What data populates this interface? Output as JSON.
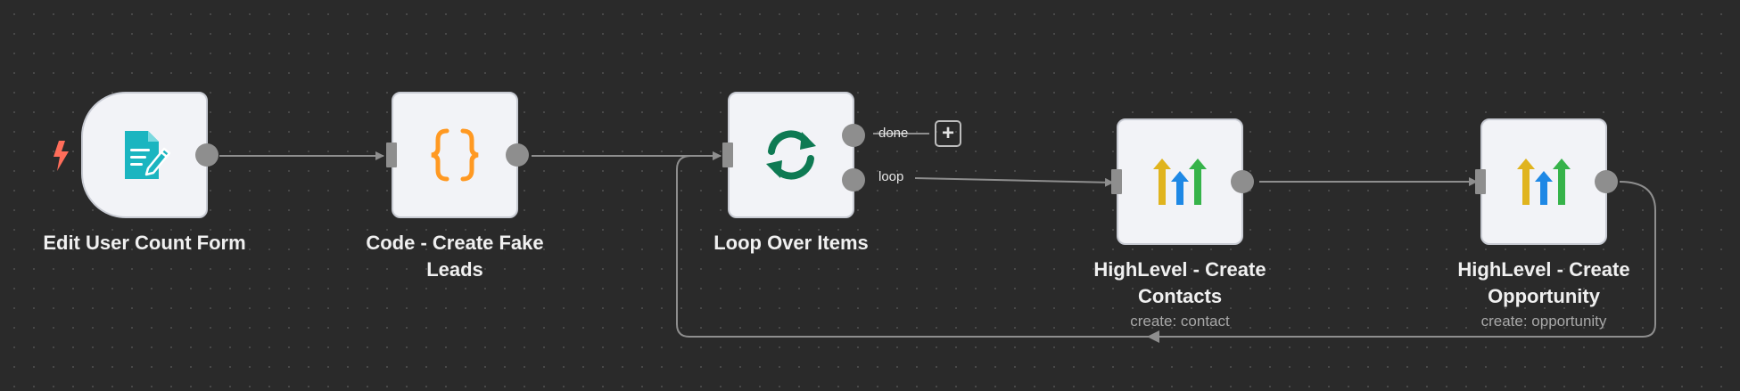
{
  "canvas": {
    "background": "#2a2a2a",
    "edge_color": "#8e8e8e"
  },
  "nodes": [
    {
      "id": "edit-user-count-form",
      "title_lines": [
        "Edit User Count Form"
      ],
      "subtitle": "",
      "icon": "form-edit-icon",
      "icon_color": "#1bb5c0",
      "trigger_icon": "lightning-bolt-icon",
      "trigger_color": "#ff6d5a"
    },
    {
      "id": "code-create-fake-leads",
      "title_lines": [
        "Code - Create Fake",
        "Leads"
      ],
      "subtitle": "",
      "icon": "code-braces-icon",
      "icon_color": "#ff9922"
    },
    {
      "id": "loop-over-items",
      "title_lines": [
        "Loop Over Items"
      ],
      "subtitle": "",
      "icon": "refresh-loop-icon",
      "icon_color": "#0e7a53",
      "outputs": [
        {
          "label": "done"
        },
        {
          "label": "loop"
        }
      ],
      "add_button": "+"
    },
    {
      "id": "highlevel-create-contacts",
      "title_lines": [
        "HighLevel - Create",
        "Contacts"
      ],
      "subtitle": "create: contact",
      "icon": "highlevel-logo-icon"
    },
    {
      "id": "highlevel-create-opportunity",
      "title_lines": [
        "HighLevel - Create",
        "Opportunity"
      ],
      "subtitle": "create: opportunity",
      "icon": "highlevel-logo-icon"
    }
  ]
}
